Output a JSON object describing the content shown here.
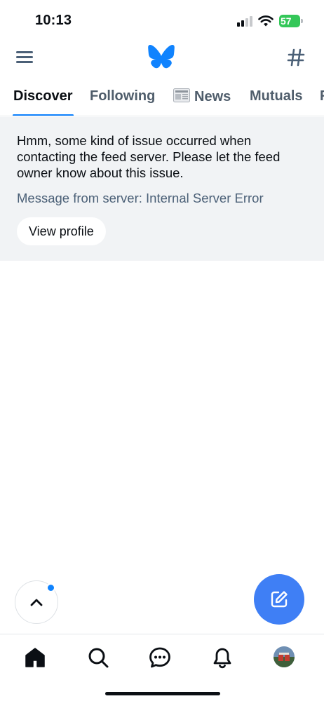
{
  "status_bar": {
    "time": "10:13",
    "battery_percent": "57",
    "battery_color": "#34c759"
  },
  "header": {
    "menu_icon": "hamburger-menu-icon",
    "logo_icon": "bluesky-butterfly-icon",
    "logo_color": "#1083fe",
    "feeds_icon": "hash-icon"
  },
  "tabs": [
    {
      "label": "Discover",
      "active": true
    },
    {
      "label": "Following",
      "active": false
    },
    {
      "label": "News",
      "emoji_icon": "newspaper-icon",
      "active": false
    },
    {
      "label": "Mutuals",
      "active": false
    },
    {
      "label": "F",
      "active": false
    }
  ],
  "error": {
    "message": "Hmm, some kind of issue occurred when contacting the feed server. Please let the feed owner know about this issue.",
    "server_message": "Message from server: Internal Server Error",
    "view_profile_label": "View profile"
  },
  "floating": {
    "scroll_top_icon": "chevron-up-icon",
    "compose_icon": "compose-icon",
    "accent_color": "#3f7ff5"
  },
  "bottom_nav": {
    "items": [
      "home-icon",
      "search-icon",
      "chat-icon",
      "bell-icon",
      "avatar"
    ]
  }
}
